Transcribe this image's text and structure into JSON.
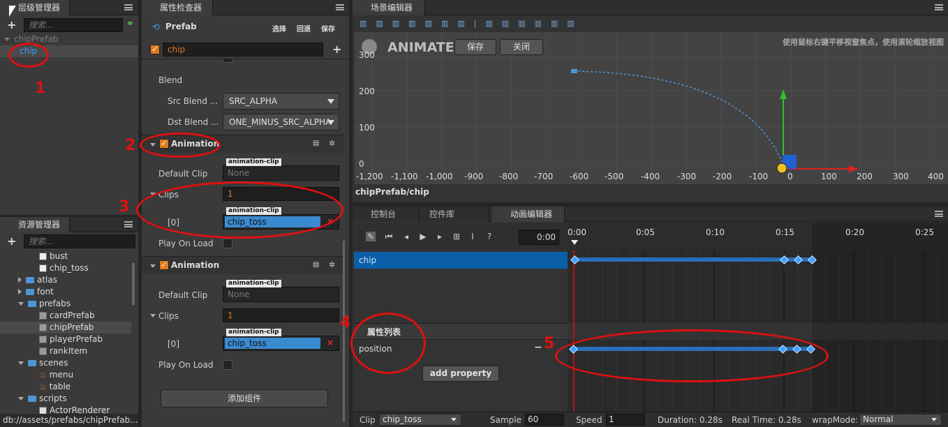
{
  "hierarchy": {
    "tab": "层级管理器",
    "search_placeholder": "搜索...",
    "root": "chipPrefab",
    "child": "chip"
  },
  "assets": {
    "tab": "资源管理器",
    "search_placeholder": "搜索...",
    "items": [
      "bust",
      "chip_toss",
      "atlas",
      "font",
      "prefabs",
      "cardPrefab",
      "chipPrefab",
      "playerPrefab",
      "rankItem",
      "scenes",
      "menu",
      "table",
      "scripts",
      "ActorRenderer"
    ],
    "status": "db://assets/prefabs/chipPrefab..."
  },
  "inspector": {
    "tab": "属性检查器",
    "title": "Prefab",
    "btn_select": "选择",
    "btn_revert": "回退",
    "btn_save": "保存",
    "node_name": "chip",
    "blend": "Blend",
    "src_blend_label": "Src Blend ...",
    "src_blend_value": "SRC_ALPHA",
    "dst_blend_label": "Dst Blend ...",
    "dst_blend_value": "ONE_MINUS_SRC_ALPHA",
    "animation_title": "Animation",
    "default_clip": "Default Clip",
    "clip_tag": "animation-clip",
    "none": "None",
    "clips": "Clips",
    "clips_count": "1",
    "index0": "[0]",
    "clip_value": "chip_toss",
    "play_on_load": "Play On Load",
    "add_component": "添加组件"
  },
  "scene": {
    "tab": "场景编辑器",
    "animate": "ANIMATE",
    "save": "保存",
    "close": "关闭",
    "hint": "使用鼠标右键平移视窗焦点，使用滚轮缩放视图",
    "x_ticks": [
      "-1,200",
      "-1,100",
      "-1,000",
      "-900",
      "-800",
      "-700",
      "-600",
      "-500",
      "-400",
      "-300",
      "-200",
      "-100",
      "0",
      "100",
      "200",
      "300",
      "400"
    ],
    "y_ticks": [
      "300",
      "200",
      "100",
      "0"
    ],
    "path": "chipPrefab/chip"
  },
  "bottom": {
    "tab_console": "控制台",
    "tab_library": "控件库",
    "tab_anim": "动画编辑器",
    "time": "0:00",
    "ruler": [
      "0:00",
      "0:05",
      "0:10",
      "0:15",
      "0:20",
      "0:25"
    ],
    "node_row": "chip",
    "prop_header": "属性列表",
    "prop_row": "position",
    "add_property": "add property",
    "clip_label": "Clip",
    "clip_value": "chip_toss",
    "sample_label": "Sample",
    "sample_value": "60",
    "speed_label": "Speed",
    "speed_value": "1",
    "duration": "Duration:  0.28s",
    "realtime": "Real Time:  0.28s",
    "wrap_label": "wrapMode:",
    "wrap_value": "Normal"
  },
  "annotations": [
    "1",
    "2",
    "3",
    "4",
    "5"
  ],
  "colors": {
    "accent": "#4f96d6",
    "selection": "#0b5fa8",
    "annotation": "#e01010",
    "check": "#e07b1f",
    "key": "#3fa0ff"
  }
}
